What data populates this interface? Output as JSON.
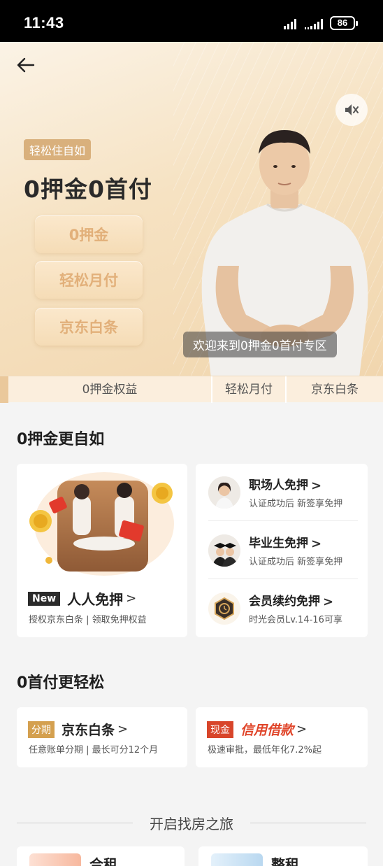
{
  "status_bar": {
    "time": "11:43",
    "battery": "86"
  },
  "hero": {
    "tag": "轻松住自如",
    "title": "0押金0首付",
    "pills": [
      "0押金",
      "轻松月付",
      "京东白条"
    ],
    "caption": "欢迎来到0押金0首付专区"
  },
  "tabs": [
    "0押金权益",
    "轻松月付",
    "京东白条"
  ],
  "section1": {
    "title": "0押金更自如",
    "feature": {
      "badge": "New",
      "label": "人人免押",
      "sub": "授权京东白条 | 领取免押权益"
    },
    "items": [
      {
        "title": "职场人免押",
        "sub": "认证成功后 新签享免押",
        "icon": "professional-woman-avatar"
      },
      {
        "title": "毕业生免押",
        "sub": "认证成功后 新签享免押",
        "icon": "graduate-avatar"
      },
      {
        "title": "会员续约免押",
        "sub": "时光会员Lv.14-16可享",
        "icon": "hexagon-member-icon"
      }
    ]
  },
  "section2": {
    "title": "0首付更轻松",
    "cards": [
      {
        "badge": "分期",
        "badge_color": "#d4a04f",
        "label": "京东白条",
        "sub": "任意账单分期 | 最长可分12个月"
      },
      {
        "badge": "现金",
        "badge_color": "#d8452a",
        "label": "信用借款",
        "sub": "极速审批，最低年化7.2%起"
      }
    ]
  },
  "divider": "开启找房之旅",
  "bottom_cards": [
    "合租",
    "整租"
  ]
}
